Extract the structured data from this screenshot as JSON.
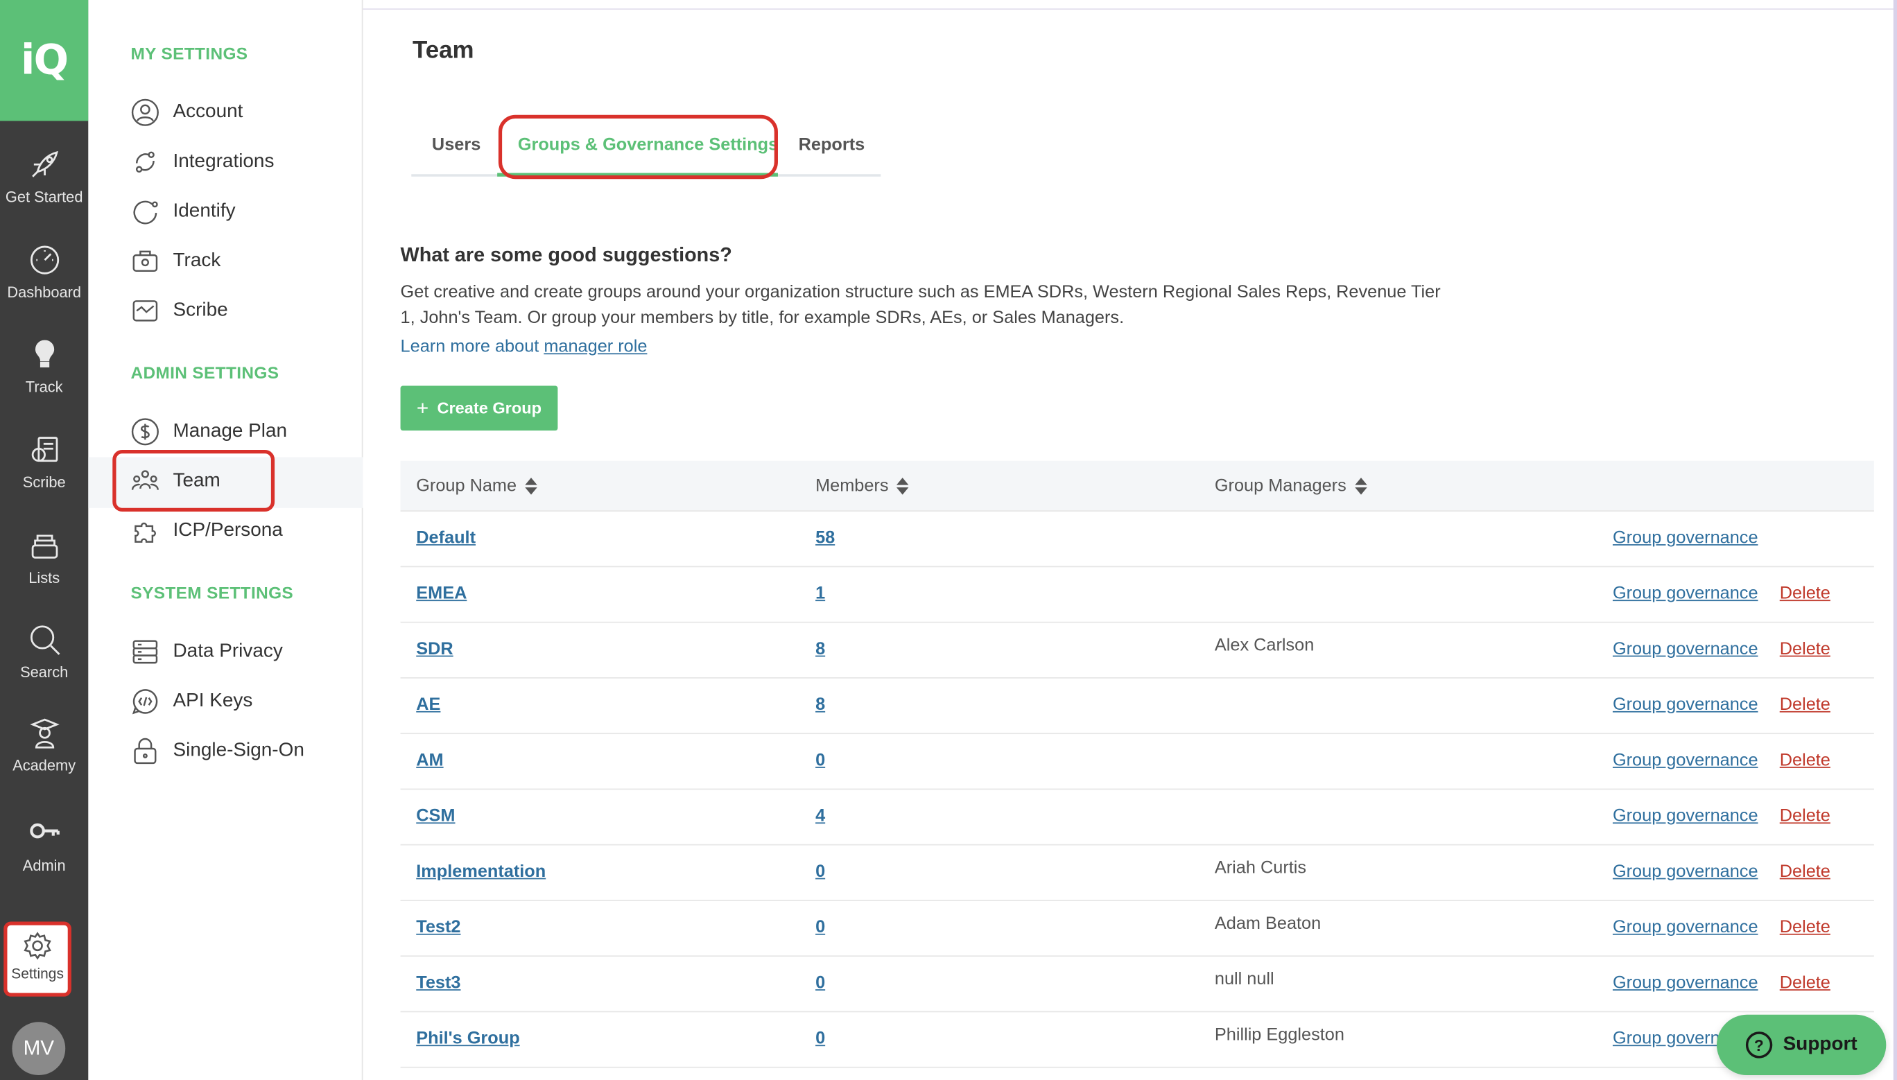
{
  "brand": {
    "logo_text": "iQ",
    "accent": "#5cc077",
    "highlight": "#d9312b"
  },
  "rail": {
    "items": [
      {
        "label": "Get Started",
        "icon": "rocket-icon"
      },
      {
        "label": "Dashboard",
        "icon": "gauge-icon"
      },
      {
        "label": "Track",
        "icon": "lightbulb-icon"
      },
      {
        "label": "Scribe",
        "icon": "scribe-icon"
      },
      {
        "label": "Lists",
        "icon": "stack-icon"
      },
      {
        "label": "Search",
        "icon": "search-icon"
      },
      {
        "label": "Academy",
        "icon": "academy-icon"
      },
      {
        "label": "Admin",
        "icon": "key-icon"
      }
    ],
    "settings_label": "Settings",
    "avatar_initials": "MV"
  },
  "sidebar": {
    "my_settings_title": "MY SETTINGS",
    "my_settings": [
      "Account",
      "Integrations",
      "Identify",
      "Track",
      "Scribe"
    ],
    "admin_settings_title": "ADMIN SETTINGS",
    "admin_settings": [
      "Manage Plan",
      "Team",
      "ICP/Persona"
    ],
    "system_settings_title": "SYSTEM SETTINGS",
    "system_settings": [
      "Data Privacy",
      "API Keys",
      "Single-Sign-On"
    ]
  },
  "main": {
    "title": "Team",
    "tabs": [
      {
        "label": "Users",
        "active": false
      },
      {
        "label": "Groups & Governance Settings",
        "active": true
      },
      {
        "label": "Reports",
        "active": false
      }
    ],
    "suggestion_title": "What are some good suggestions?",
    "suggestion_body": "Get creative and create groups around your organization structure such as EMEA SDRs, Western Regional Sales Reps, Revenue Tier 1, John's Team. Or group your members by title, for example SDRs, AEs, or Sales Managers.",
    "learn_more_prefix": "Learn more about",
    "learn_more_link": "manager role",
    "create_button": "Create Group"
  },
  "table": {
    "columns": [
      "Group Name",
      "Members",
      "Group Managers"
    ],
    "rows": [
      {
        "name": "Default",
        "members": "58",
        "manager": "",
        "governance": "Group governance",
        "delete": ""
      },
      {
        "name": "EMEA",
        "members": "1",
        "manager": "",
        "governance": "Group governance",
        "delete": "Delete"
      },
      {
        "name": "SDR",
        "members": "8",
        "manager": "Alex Carlson",
        "governance": "Group governance",
        "delete": "Delete"
      },
      {
        "name": "AE",
        "members": "8",
        "manager": "",
        "governance": "Group governance",
        "delete": "Delete"
      },
      {
        "name": "AM",
        "members": "0",
        "manager": "",
        "governance": "Group governance",
        "delete": "Delete"
      },
      {
        "name": "CSM",
        "members": "4",
        "manager": "",
        "governance": "Group governance",
        "delete": "Delete"
      },
      {
        "name": "Implementation",
        "members": "0",
        "manager": "Ariah Curtis",
        "governance": "Group governance",
        "delete": "Delete"
      },
      {
        "name": "Test2",
        "members": "0",
        "manager": "Adam Beaton",
        "governance": "Group governance",
        "delete": "Delete"
      },
      {
        "name": "Test3",
        "members": "0",
        "manager": "null null",
        "governance": "Group governance",
        "delete": "Delete"
      },
      {
        "name": "Phil's Group",
        "members": "0",
        "manager": "Phillip Eggleston",
        "governance": "Group govern",
        "delete": ""
      }
    ]
  },
  "support": {
    "label": "Support"
  }
}
